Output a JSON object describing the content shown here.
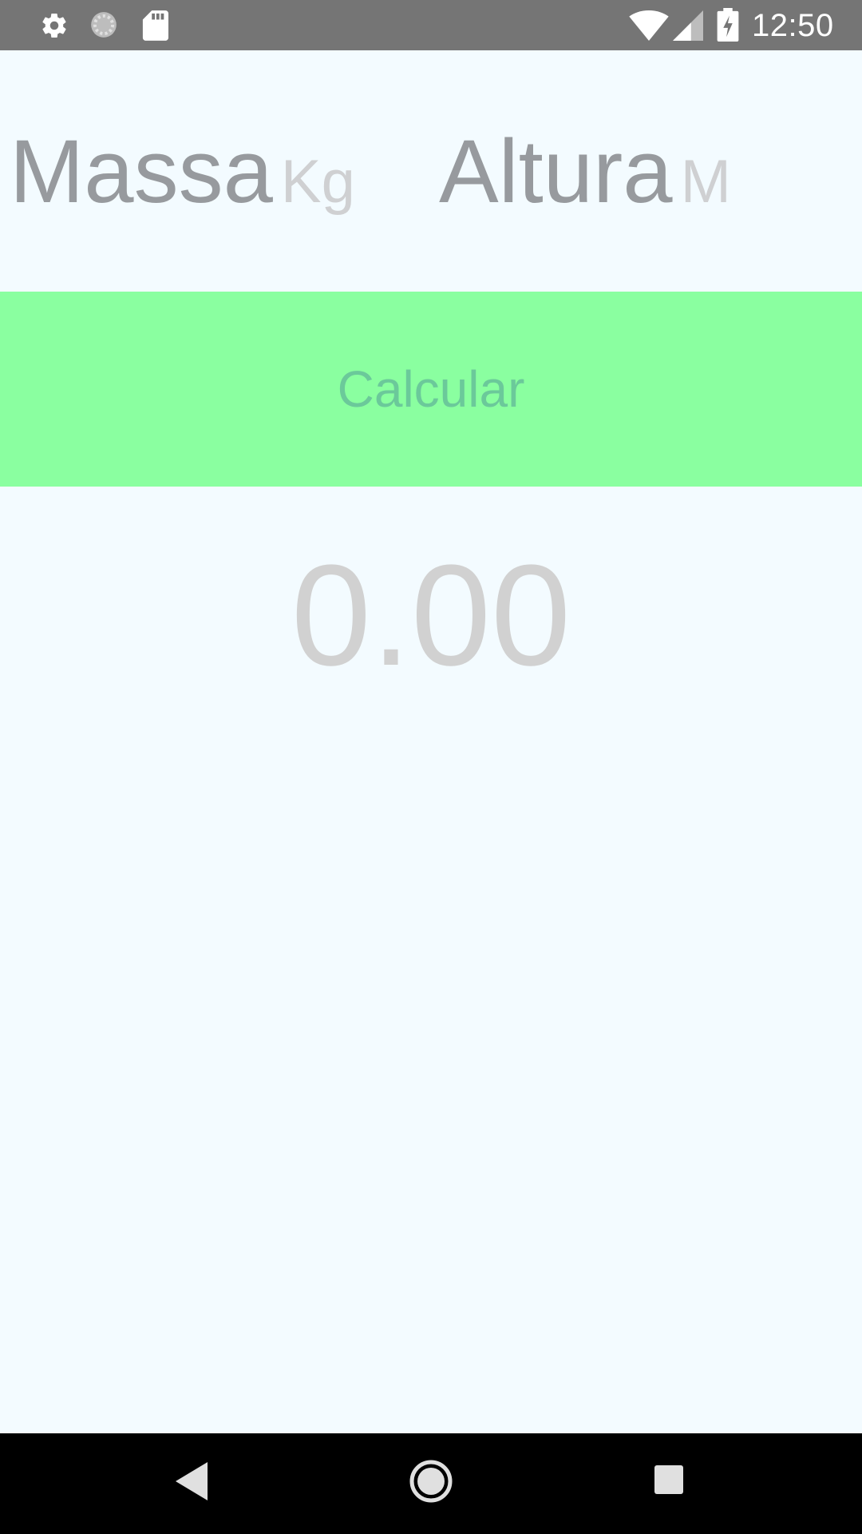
{
  "status_bar": {
    "time": "12:50",
    "left_icons": [
      "gear-icon",
      "sync-icon",
      "sd-card-icon"
    ],
    "right_icons": [
      "wifi-icon",
      "signal-icon",
      "battery-charging-icon"
    ]
  },
  "inputs": {
    "mass": {
      "value": "Massa",
      "placeholder": "Kg"
    },
    "height": {
      "value": "Altura",
      "placeholder": "M"
    }
  },
  "calculate_button": {
    "label": "Calcular"
  },
  "result": {
    "value": "0.00"
  },
  "nav_bar": {
    "icons": [
      "back-icon",
      "home-icon",
      "recents-icon"
    ]
  },
  "colors": {
    "background": "#F3FBFF",
    "status_bar": "#757575",
    "button": "#8AFFA0",
    "button_text": "#6BC99A",
    "input_text": "#979A9E",
    "placeholder_text": "#CFD0D2",
    "result_text": "#D1D1D1"
  }
}
